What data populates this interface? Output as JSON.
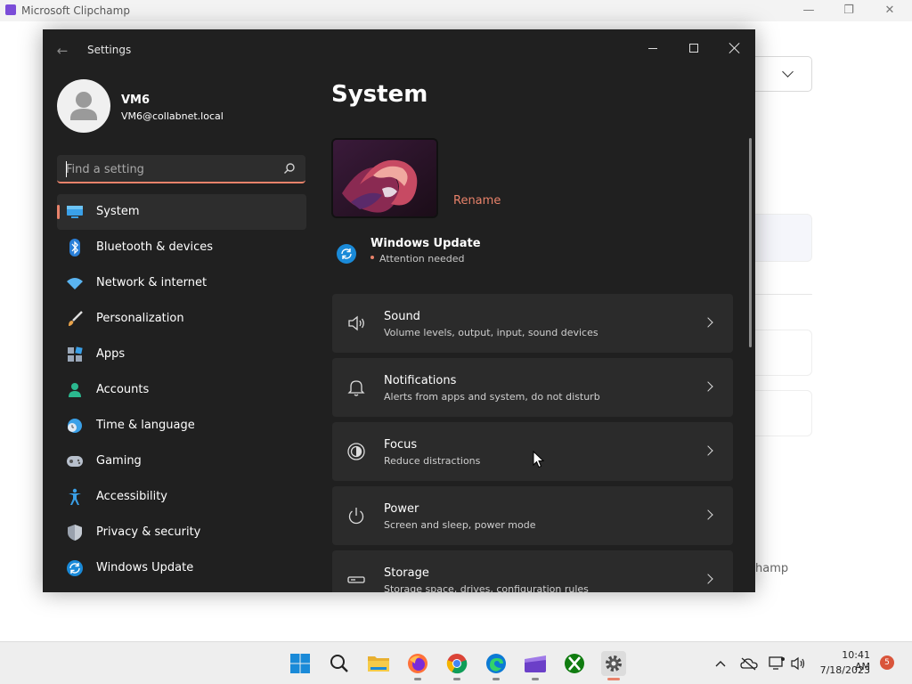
{
  "background_app": {
    "title": "Microsoft Clipchamp",
    "partial_text": "hamp"
  },
  "window": {
    "app_title": "Settings",
    "back_icon": "back-arrow-icon"
  },
  "profile": {
    "name": "VM6",
    "email": "VM6@collabnet.local"
  },
  "search": {
    "placeholder": "Find a setting",
    "value": ""
  },
  "sidebar": {
    "items": [
      {
        "label": "System",
        "icon": "system-icon",
        "active": true
      },
      {
        "label": "Bluetooth & devices",
        "icon": "bluetooth-icon"
      },
      {
        "label": "Network & internet",
        "icon": "wifi-icon"
      },
      {
        "label": "Personalization",
        "icon": "brush-icon"
      },
      {
        "label": "Apps",
        "icon": "apps-icon"
      },
      {
        "label": "Accounts",
        "icon": "accounts-icon"
      },
      {
        "label": "Time & language",
        "icon": "globe-clock-icon"
      },
      {
        "label": "Gaming",
        "icon": "gamepad-icon"
      },
      {
        "label": "Accessibility",
        "icon": "accessibility-icon"
      },
      {
        "label": "Privacy & security",
        "icon": "shield-icon"
      },
      {
        "label": "Windows Update",
        "icon": "update-icon"
      }
    ]
  },
  "main": {
    "title": "System",
    "rename_label": "Rename",
    "windows_update": {
      "title": "Windows Update",
      "status": "Attention needed"
    },
    "cards": [
      {
        "title": "Sound",
        "subtitle": "Volume levels, output, input, sound devices",
        "icon": "speaker-icon"
      },
      {
        "title": "Notifications",
        "subtitle": "Alerts from apps and system, do not disturb",
        "icon": "bell-icon"
      },
      {
        "title": "Focus",
        "subtitle": "Reduce distractions",
        "icon": "focus-icon"
      },
      {
        "title": "Power",
        "subtitle": "Screen and sleep, power mode",
        "icon": "power-icon"
      },
      {
        "title": "Storage",
        "subtitle": "Storage space, drives, configuration rules",
        "icon": "storage-icon"
      }
    ]
  },
  "taskbar": {
    "apps": [
      "start-icon",
      "search-icon",
      "file-explorer-icon",
      "firefox-icon",
      "chrome-icon",
      "edge-icon",
      "clipchamp-icon",
      "xbox-icon",
      "settings-icon"
    ],
    "time": "10:41 AM",
    "date": "7/18/2023",
    "notification_count": "5"
  },
  "colors": {
    "accent": "#e8826a",
    "window_bg": "#202020",
    "card_bg": "#2b2b2b"
  }
}
